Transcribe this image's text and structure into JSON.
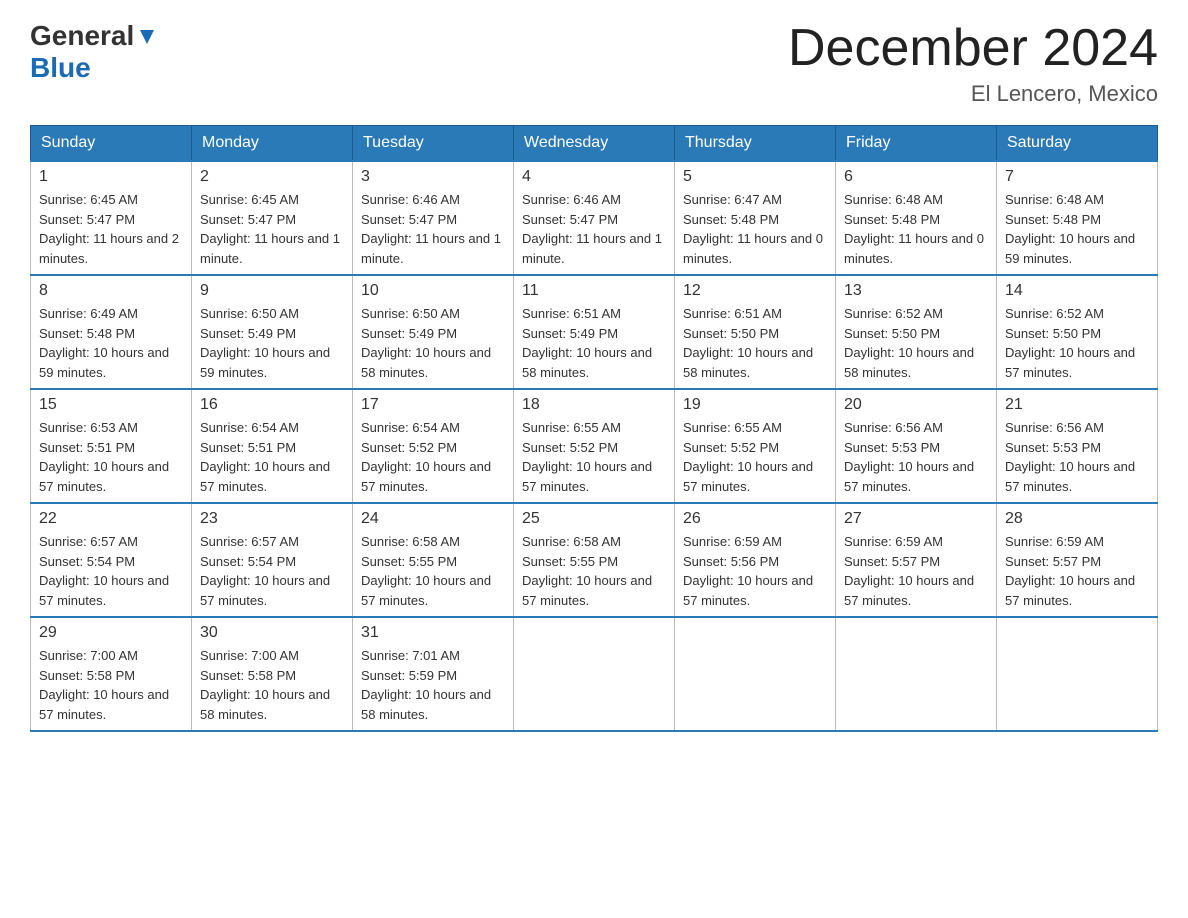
{
  "logo": {
    "general": "General",
    "blue": "Blue",
    "arrow": "▲"
  },
  "title": "December 2024",
  "location": "El Lencero, Mexico",
  "days_of_week": [
    "Sunday",
    "Monday",
    "Tuesday",
    "Wednesday",
    "Thursday",
    "Friday",
    "Saturday"
  ],
  "weeks": [
    [
      {
        "day": "1",
        "sunrise": "6:45 AM",
        "sunset": "5:47 PM",
        "daylight": "11 hours and 2 minutes."
      },
      {
        "day": "2",
        "sunrise": "6:45 AM",
        "sunset": "5:47 PM",
        "daylight": "11 hours and 1 minute."
      },
      {
        "day": "3",
        "sunrise": "6:46 AM",
        "sunset": "5:47 PM",
        "daylight": "11 hours and 1 minute."
      },
      {
        "day": "4",
        "sunrise": "6:46 AM",
        "sunset": "5:47 PM",
        "daylight": "11 hours and 1 minute."
      },
      {
        "day": "5",
        "sunrise": "6:47 AM",
        "sunset": "5:48 PM",
        "daylight": "11 hours and 0 minutes."
      },
      {
        "day": "6",
        "sunrise": "6:48 AM",
        "sunset": "5:48 PM",
        "daylight": "11 hours and 0 minutes."
      },
      {
        "day": "7",
        "sunrise": "6:48 AM",
        "sunset": "5:48 PM",
        "daylight": "10 hours and 59 minutes."
      }
    ],
    [
      {
        "day": "8",
        "sunrise": "6:49 AM",
        "sunset": "5:48 PM",
        "daylight": "10 hours and 59 minutes."
      },
      {
        "day": "9",
        "sunrise": "6:50 AM",
        "sunset": "5:49 PM",
        "daylight": "10 hours and 59 minutes."
      },
      {
        "day": "10",
        "sunrise": "6:50 AM",
        "sunset": "5:49 PM",
        "daylight": "10 hours and 58 minutes."
      },
      {
        "day": "11",
        "sunrise": "6:51 AM",
        "sunset": "5:49 PM",
        "daylight": "10 hours and 58 minutes."
      },
      {
        "day": "12",
        "sunrise": "6:51 AM",
        "sunset": "5:50 PM",
        "daylight": "10 hours and 58 minutes."
      },
      {
        "day": "13",
        "sunrise": "6:52 AM",
        "sunset": "5:50 PM",
        "daylight": "10 hours and 58 minutes."
      },
      {
        "day": "14",
        "sunrise": "6:52 AM",
        "sunset": "5:50 PM",
        "daylight": "10 hours and 57 minutes."
      }
    ],
    [
      {
        "day": "15",
        "sunrise": "6:53 AM",
        "sunset": "5:51 PM",
        "daylight": "10 hours and 57 minutes."
      },
      {
        "day": "16",
        "sunrise": "6:54 AM",
        "sunset": "5:51 PM",
        "daylight": "10 hours and 57 minutes."
      },
      {
        "day": "17",
        "sunrise": "6:54 AM",
        "sunset": "5:52 PM",
        "daylight": "10 hours and 57 minutes."
      },
      {
        "day": "18",
        "sunrise": "6:55 AM",
        "sunset": "5:52 PM",
        "daylight": "10 hours and 57 minutes."
      },
      {
        "day": "19",
        "sunrise": "6:55 AM",
        "sunset": "5:52 PM",
        "daylight": "10 hours and 57 minutes."
      },
      {
        "day": "20",
        "sunrise": "6:56 AM",
        "sunset": "5:53 PM",
        "daylight": "10 hours and 57 minutes."
      },
      {
        "day": "21",
        "sunrise": "6:56 AM",
        "sunset": "5:53 PM",
        "daylight": "10 hours and 57 minutes."
      }
    ],
    [
      {
        "day": "22",
        "sunrise": "6:57 AM",
        "sunset": "5:54 PM",
        "daylight": "10 hours and 57 minutes."
      },
      {
        "day": "23",
        "sunrise": "6:57 AM",
        "sunset": "5:54 PM",
        "daylight": "10 hours and 57 minutes."
      },
      {
        "day": "24",
        "sunrise": "6:58 AM",
        "sunset": "5:55 PM",
        "daylight": "10 hours and 57 minutes."
      },
      {
        "day": "25",
        "sunrise": "6:58 AM",
        "sunset": "5:55 PM",
        "daylight": "10 hours and 57 minutes."
      },
      {
        "day": "26",
        "sunrise": "6:59 AM",
        "sunset": "5:56 PM",
        "daylight": "10 hours and 57 minutes."
      },
      {
        "day": "27",
        "sunrise": "6:59 AM",
        "sunset": "5:57 PM",
        "daylight": "10 hours and 57 minutes."
      },
      {
        "day": "28",
        "sunrise": "6:59 AM",
        "sunset": "5:57 PM",
        "daylight": "10 hours and 57 minutes."
      }
    ],
    [
      {
        "day": "29",
        "sunrise": "7:00 AM",
        "sunset": "5:58 PM",
        "daylight": "10 hours and 57 minutes."
      },
      {
        "day": "30",
        "sunrise": "7:00 AM",
        "sunset": "5:58 PM",
        "daylight": "10 hours and 58 minutes."
      },
      {
        "day": "31",
        "sunrise": "7:01 AM",
        "sunset": "5:59 PM",
        "daylight": "10 hours and 58 minutes."
      },
      null,
      null,
      null,
      null
    ]
  ]
}
